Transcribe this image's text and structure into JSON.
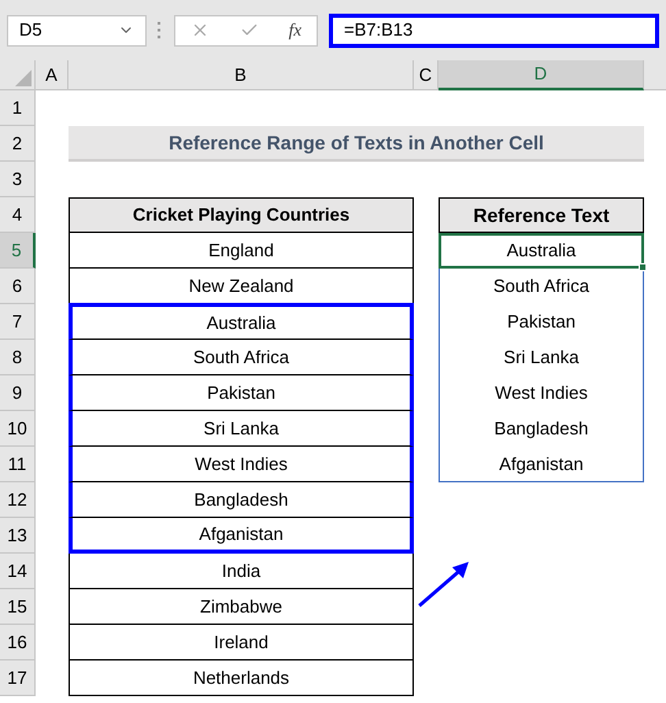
{
  "name_box": "D5",
  "function_label": "fx",
  "formula": "=B7:B13",
  "columns": [
    {
      "label": "A",
      "selected": false
    },
    {
      "label": "B",
      "selected": false
    },
    {
      "label": "C",
      "selected": false
    },
    {
      "label": "D",
      "selected": true
    }
  ],
  "rows": [
    {
      "label": "1",
      "selected": false
    },
    {
      "label": "2",
      "selected": false
    },
    {
      "label": "3",
      "selected": false
    },
    {
      "label": "4",
      "selected": false
    },
    {
      "label": "5",
      "selected": true
    },
    {
      "label": "6",
      "selected": false
    },
    {
      "label": "7",
      "selected": false
    },
    {
      "label": "8",
      "selected": false
    },
    {
      "label": "9",
      "selected": false
    },
    {
      "label": "10",
      "selected": false
    },
    {
      "label": "11",
      "selected": false
    },
    {
      "label": "12",
      "selected": false
    },
    {
      "label": "13",
      "selected": false
    },
    {
      "label": "14",
      "selected": false
    },
    {
      "label": "15",
      "selected": false
    },
    {
      "label": "16",
      "selected": false
    },
    {
      "label": "17",
      "selected": false
    }
  ],
  "title": "Reference Range of Texts in Another Cell",
  "countries": {
    "header": "Cricket Playing Countries",
    "items": [
      {
        "text": "England",
        "highlighted": false
      },
      {
        "text": "New Zealand",
        "highlighted": false
      },
      {
        "text": "Australia",
        "highlighted": true
      },
      {
        "text": "South Africa",
        "highlighted": true
      },
      {
        "text": "Pakistan",
        "highlighted": true
      },
      {
        "text": "Sri Lanka",
        "highlighted": true
      },
      {
        "text": "West Indies",
        "highlighted": true
      },
      {
        "text": "Bangladesh",
        "highlighted": true
      },
      {
        "text": "Afganistan",
        "highlighted": true
      },
      {
        "text": "India",
        "highlighted": false
      },
      {
        "text": "Zimbabwe",
        "highlighted": false
      },
      {
        "text": "Ireland",
        "highlighted": false
      },
      {
        "text": "Netherlands",
        "highlighted": false
      }
    ]
  },
  "reference": {
    "header": "Reference Text",
    "items": [
      {
        "text": "Australia",
        "selected": true
      },
      {
        "text": "South Africa",
        "selected": false
      },
      {
        "text": "Pakistan",
        "selected": false
      },
      {
        "text": "Sri Lanka",
        "selected": false
      },
      {
        "text": "West Indies",
        "selected": false
      },
      {
        "text": "Bangladesh",
        "selected": false
      },
      {
        "text": "Afganistan",
        "selected": false
      }
    ]
  }
}
